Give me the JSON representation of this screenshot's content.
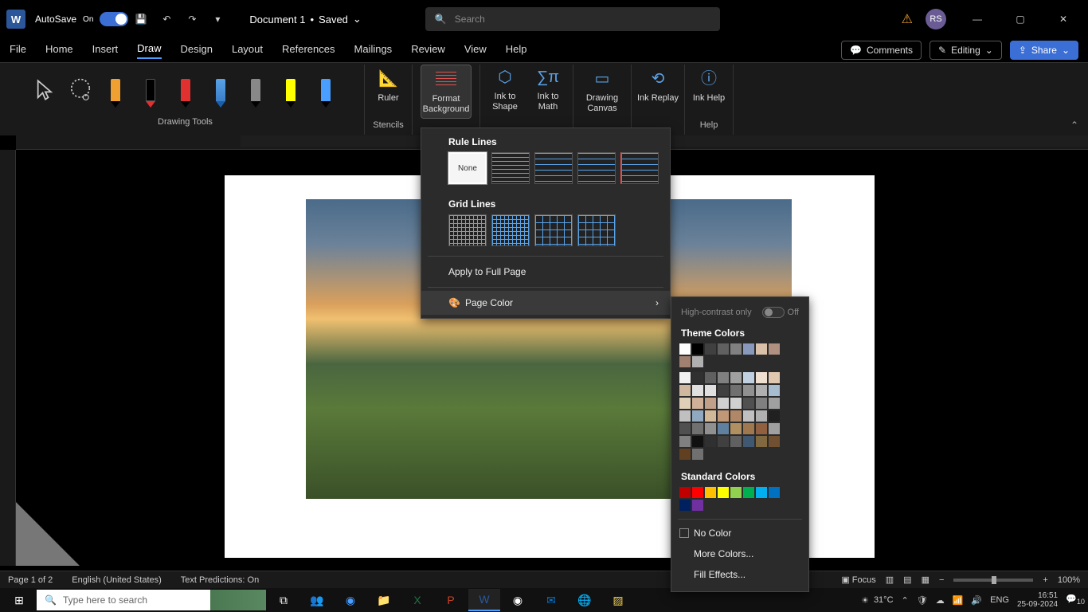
{
  "titlebar": {
    "autosave_label": "AutoSave",
    "autosave_state": "On",
    "doc_name": "Document 1",
    "saved_state": "Saved",
    "search_placeholder": "Search",
    "avatar_initials": "RS"
  },
  "tabs": {
    "items": [
      "File",
      "Home",
      "Insert",
      "Draw",
      "Design",
      "Layout",
      "References",
      "Mailings",
      "Review",
      "View",
      "Help"
    ],
    "active": "Draw",
    "comments": "Comments",
    "editing": "Editing",
    "share": "Share"
  },
  "ribbon": {
    "drawing_tools_label": "Drawing Tools",
    "stencils_label": "Stencils",
    "help_label": "Help",
    "ruler": "Ruler",
    "format_background": "Format Background",
    "ink_to_shape": "Ink to Shape",
    "ink_to_math": "Ink to Math",
    "drawing_canvas": "Drawing Canvas",
    "ink_replay": "Ink Replay",
    "ink_help": "Ink Help",
    "pens": [
      {
        "color": "#f0a030",
        "tip": "#000"
      },
      {
        "color": "#000",
        "tip": "#e03030"
      },
      {
        "color": "#e03030",
        "tip": "#000"
      },
      {
        "color": "#5aa3e8",
        "tip": "#000"
      },
      {
        "color": "#888",
        "tip": "#000"
      },
      {
        "color": "#ffff00",
        "tip": "#000"
      },
      {
        "color": "#4a9eff",
        "tip": "#000"
      }
    ]
  },
  "dropdown1": {
    "rule_lines": "Rule Lines",
    "none": "None",
    "grid_lines": "Grid Lines",
    "apply_full": "Apply to Full Page",
    "page_color": "Page Color"
  },
  "dropdown2": {
    "high_contrast": "High-contrast only",
    "hc_state": "Off",
    "theme_colors": "Theme Colors",
    "standard_colors": "Standard Colors",
    "no_color": "No Color",
    "more_colors": "More Colors...",
    "fill_effects": "Fill Effects...",
    "theme_row1": [
      "#ffffff",
      "#000000",
      "#404040",
      "#606060",
      "#808080",
      "#8899bb",
      "#d9c0a8",
      "#b09080",
      "#a08070",
      "#b0b0b0"
    ],
    "theme_shades": [
      [
        "#f0f0f0",
        "#303030",
        "#606060",
        "#808080",
        "#a0a0a0",
        "#c0d0e0",
        "#f0e0d0",
        "#e0c8b0",
        "#d0b8a0",
        "#e0e0e0"
      ],
      [
        "#e0e0e0",
        "#404040",
        "#707070",
        "#909090",
        "#b0b0b0",
        "#a8bcd0",
        "#e0d0b8",
        "#d0b098",
        "#c0a088",
        "#d0d0d0"
      ],
      [
        "#d0d0d0",
        "#505050",
        "#808080",
        "#a0a0a0",
        "#c0c0c0",
        "#90a8c0",
        "#d0b898",
        "#c09878",
        "#b08868",
        "#c0c0c0"
      ],
      [
        "#b0b0b0",
        "#202020",
        "#505050",
        "#707070",
        "#909090",
        "#6080a0",
        "#b09060",
        "#a07850",
        "#906040",
        "#a0a0a0"
      ],
      [
        "#808080",
        "#101010",
        "#303030",
        "#404040",
        "#606060",
        "#405870",
        "#806840",
        "#705030",
        "#604020",
        "#707070"
      ]
    ],
    "standard_row": [
      "#c00000",
      "#ff0000",
      "#ffc000",
      "#ffff00",
      "#92d050",
      "#00b050",
      "#00b0f0",
      "#0070c0",
      "#002060",
      "#7030a0"
    ]
  },
  "statusbar": {
    "page": "Page 1 of 2",
    "language": "English (United States)",
    "predictions": "Text Predictions: On",
    "focus": "Focus",
    "zoom": "100%"
  },
  "taskbar": {
    "search_placeholder": "Type here to search",
    "temp": "31°C",
    "lang": "ENG",
    "time": "16:51",
    "date": "25-09-2024",
    "notif_count": "10"
  }
}
